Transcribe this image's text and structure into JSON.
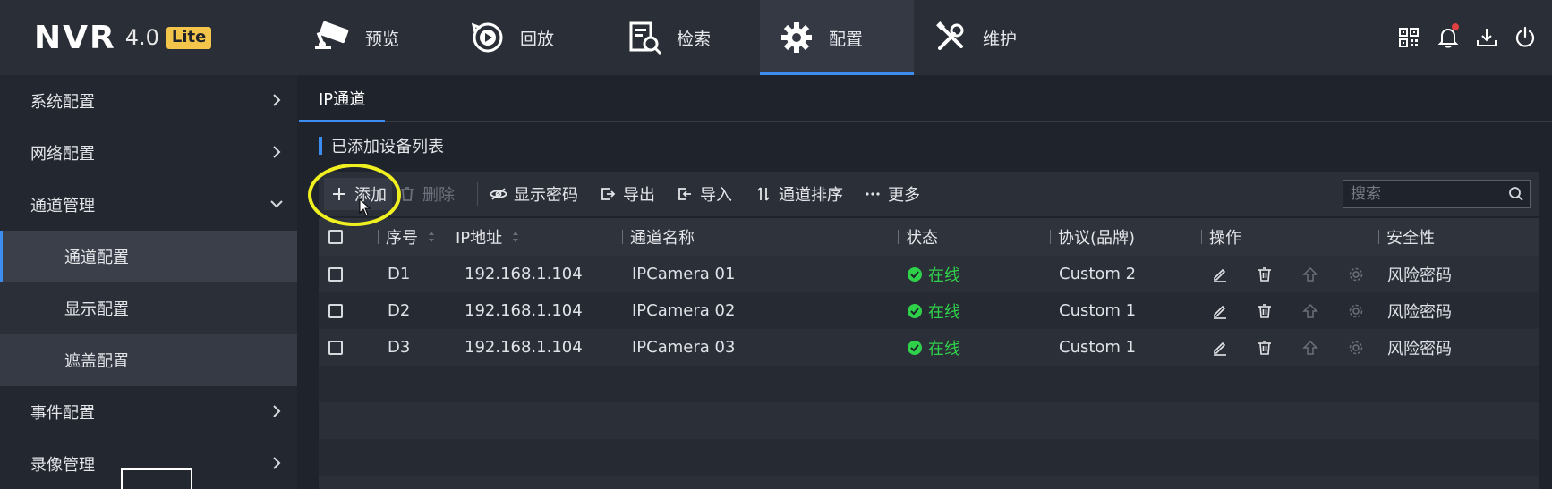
{
  "app": {
    "logo": {
      "name": "NVR",
      "version": "4.0",
      "edition": "Lite"
    }
  },
  "nav": [
    {
      "id": "preview",
      "label": "预览",
      "icon": "camera-icon"
    },
    {
      "id": "playback",
      "label": "回放",
      "icon": "playback-icon"
    },
    {
      "id": "search",
      "label": "检索",
      "icon": "search-doc-icon"
    },
    {
      "id": "config",
      "label": "配置",
      "icon": "gear-icon",
      "active": true
    },
    {
      "id": "maintenance",
      "label": "维护",
      "icon": "tools-icon"
    }
  ],
  "top_icons": [
    "qrcode-icon",
    "bell-icon",
    "download-icon",
    "power-icon"
  ],
  "sidebar": {
    "items": [
      {
        "label": "系统配置",
        "type": "top"
      },
      {
        "label": "网络配置",
        "type": "top"
      },
      {
        "label": "通道管理",
        "type": "top",
        "expanded": true
      },
      {
        "label": "通道配置",
        "type": "sub",
        "selected": true
      },
      {
        "label": "显示配置",
        "type": "sub"
      },
      {
        "label": "遮盖配置",
        "type": "sub"
      },
      {
        "label": "事件配置",
        "type": "top"
      },
      {
        "label": "录像管理",
        "type": "top"
      }
    ]
  },
  "content": {
    "tab": "IP通道",
    "section_title": "已添加设备列表",
    "toolbar": {
      "add": "添加",
      "delete": "删除",
      "show_password": "显示密码",
      "export": "导出",
      "import": "导入",
      "sort_channels": "通道排序",
      "more": "更多",
      "search_placeholder": "搜索"
    },
    "table": {
      "headers": {
        "index": "序号",
        "ip": "IP地址",
        "name": "通道名称",
        "status": "状态",
        "protocol": "协议(品牌)",
        "actions": "操作",
        "security": "安全性"
      },
      "rows": [
        {
          "index": "D1",
          "ip": "192.168.1.104",
          "name": "IPCamera 01",
          "status": "在线",
          "protocol": "Custom 2",
          "security": "风险密码"
        },
        {
          "index": "D2",
          "ip": "192.168.1.104",
          "name": "IPCamera 02",
          "status": "在线",
          "protocol": "Custom 1",
          "security": "风险密码"
        },
        {
          "index": "D3",
          "ip": "192.168.1.104",
          "name": "IPCamera 03",
          "status": "在线",
          "protocol": "Custom 1",
          "security": "风险密码"
        }
      ]
    }
  },
  "colors": {
    "accent": "#3d8cf0",
    "online": "#2fd14b",
    "highlight": "#f0f020",
    "lite_badge": "#f3c54a"
  }
}
